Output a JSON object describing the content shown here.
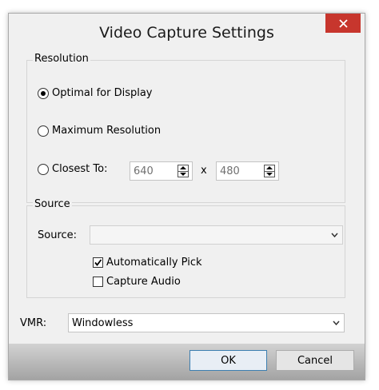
{
  "window": {
    "title": "Video Capture Settings",
    "close_icon": "close-icon"
  },
  "resolution": {
    "group_label": "Resolution",
    "options": [
      {
        "label": "Optimal for Display",
        "checked": true
      },
      {
        "label": "Maximum Resolution",
        "checked": false
      },
      {
        "label": "Closest To:",
        "checked": false
      }
    ],
    "width_value": "640",
    "height_value": "480",
    "separator": "x"
  },
  "source": {
    "group_label": "Source",
    "field_label": "Source:",
    "value": "",
    "auto_pick_label": "Automatically Pick",
    "auto_pick_checked": true,
    "capture_audio_label": "Capture Audio",
    "capture_audio_checked": false
  },
  "vmr": {
    "label": "VMR:",
    "value": "Windowless"
  },
  "buttons": {
    "ok": "OK",
    "cancel": "Cancel"
  },
  "colors": {
    "close_button": "#c7362d",
    "default_button_border": "#3c7fb1"
  }
}
